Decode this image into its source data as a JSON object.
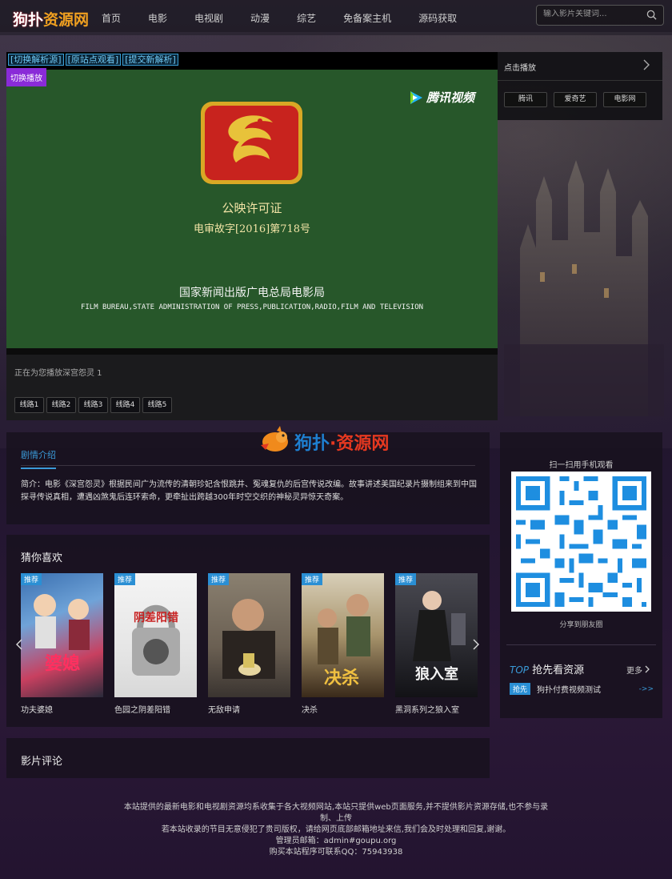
{
  "site": {
    "logo_part1": "狗扑",
    "logo_part2": "资源网"
  },
  "nav": [
    "首页",
    "电影",
    "电视剧",
    "动漫",
    "综艺",
    "免备案主机",
    "源码获取"
  ],
  "search": {
    "placeholder": "输入影片关键词..."
  },
  "player": {
    "links": [
      "[切换解析源]",
      "[原站点观看]",
      "[提交新解析]"
    ],
    "switch_label": "切换播放",
    "brand": "腾讯视频",
    "license_title": "公映许可证",
    "license_no": "电审故字[2016]第718号",
    "bureau_cn": "国家新闻出版广电总局电影局",
    "bureau_en": "FILM BUREAU,STATE ADMINISTRATION OF PRESS,PUBLICATION,RADIO,FILM AND TELEVISION",
    "now_playing": "正在为您播放深宫怨灵 1",
    "lines": [
      "线路1",
      "线路2",
      "线路3",
      "线路4",
      "线路5"
    ]
  },
  "side_play": {
    "title": "点击播放",
    "sources": [
      "腾讯",
      "爱奇艺",
      "电影网"
    ]
  },
  "watermark": {
    "part1": "狗扑",
    "dot": "·",
    "part2": "资源网"
  },
  "intro": {
    "tab": "剧情介绍",
    "text": "简介：电影《深宫怨灵》根据民间广为流传的清朝珍妃含恨跳井、冤魂复仇的后宫传说改编。故事讲述美国纪录片摄制组来到中国探寻传说真相，遭遇凶煞鬼后连环索命，更牵扯出跨越300年时空交织的神秘灵异惊天奇案。"
  },
  "guess": {
    "title": "猜你喜欢",
    "badge": "推荐",
    "items": [
      {
        "name": "功夫婆媳",
        "badge": "推荐"
      },
      {
        "name": "色园之阴差阳错",
        "badge": "推荐"
      },
      {
        "name": "无敌申请",
        "badge": "推荐"
      },
      {
        "name": "决杀",
        "badge": "推荐"
      },
      {
        "name": "黑洞系列之狼入室",
        "badge": "推荐"
      }
    ]
  },
  "comment": {
    "title": "影片评论"
  },
  "qr": {
    "title": "扫一扫用手机观看",
    "share": "分享到朋友圈"
  },
  "top_res": {
    "tp": "TOP",
    "title": "抢先看资源",
    "more": "更多",
    "item_tag": "抢先",
    "item_name": "狗扑付费视频测试",
    "item_go": "->>"
  },
  "footer": {
    "line1": "本站提供的最新电影和电视剧资源均系收集于各大视频网站,本站只提供web页面服务,并不提供影片资源存储,也不参与录制、上传",
    "line2": "若本站收录的节目无意侵犯了贵司版权，请给网页底部邮箱地址来信,我们会及时处理和回复,谢谢。",
    "line3": "管理员邮箱：admin#goupu.org",
    "line4": "购买本站程序可联系QQ：75943938"
  },
  "colors": {
    "accent": "#3a9ad8",
    "switch": "#8a2bd8",
    "video_bg": "#27572a",
    "logo_orange": "#f0a020"
  }
}
